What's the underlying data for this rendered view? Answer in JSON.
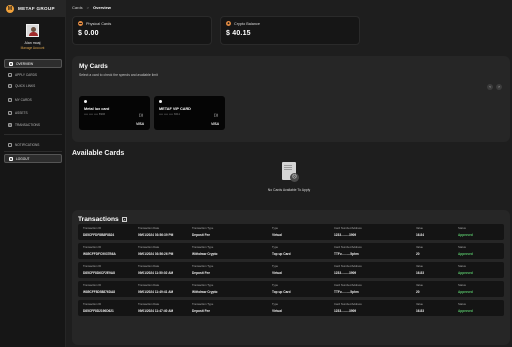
{
  "app": {
    "logo_text": "METAF GROUP"
  },
  "profile": {
    "name": "Alan moaj",
    "link": "Manage Account"
  },
  "nav": {
    "items": [
      {
        "label": "OVERVIEW",
        "icon": "O"
      },
      {
        "label": "APPLY CARDS",
        "icon": "+"
      },
      {
        "label": "QUICK LINKS",
        "icon": "≡"
      },
      {
        "label": "MY CARDS",
        "icon": "▭"
      },
      {
        "label": "ASSETS",
        "icon": "◇"
      },
      {
        "label": "TRANSACTIONS",
        "icon": "⇄"
      }
    ],
    "notifications": {
      "label": "NOTIFICATIONS",
      "icon": "!"
    },
    "logout": {
      "label": "LOGOUT",
      "icon": "⏻"
    }
  },
  "breadcrumb": {
    "root": "Cards",
    "separator": ">",
    "current": "Overview"
  },
  "stats": [
    {
      "label": "Physical Cards",
      "value": "$ 0.00",
      "icon": "credit-card-icon"
    },
    {
      "label": "Crypto Balance",
      "value": "$ 40.15",
      "icon": "crypto-icon"
    }
  ],
  "my_cards": {
    "title": "My Cards",
    "subtitle": "Select a card to check the spends and available limit",
    "cards": [
      {
        "name": "Metal lux card",
        "number": "•••• •••• •••• 8906",
        "brand": "VISA"
      },
      {
        "name": "METAF VIP CARD",
        "number": "•••• •••• •••• 3011",
        "brand": "VISA"
      }
    ],
    "prev": "‹",
    "next": "›"
  },
  "available_cards": {
    "title": "Available Cards",
    "empty_text": "No Cards Available To Apply"
  },
  "transactions": {
    "title": "Transactions",
    "headers": {
      "id": "Transaction ID",
      "date": "Transaction Date",
      "type": "Transaction Type",
      "kind": "Type",
      "card": "Card Number/Address",
      "value": "Value",
      "status": "Status"
    },
    "rows": [
      {
        "id": "D85CFFDF8B8F8824",
        "date": "09/01/2024 03:56:39 PM",
        "type": "Deposit Fee",
        "kind": "Virtual",
        "card": "1233.........3909",
        "value": "16.84",
        "status": "Approved"
      },
      {
        "id": "W85CFFDFC9037B6A",
        "date": "09/01/2024 03:56:26 PM",
        "type": "Withdraw Crypto",
        "kind": "Top up Card",
        "card": "TTFv..........5phm",
        "value": "20",
        "status": "Approved"
      },
      {
        "id": "D85CFF8D6CF2E9A8",
        "date": "09/01/2024 11:50:02 AM",
        "type": "Deposit Fee",
        "kind": "Virtual",
        "card": "1233.........3909",
        "value": "16.83",
        "status": "Approved"
      },
      {
        "id": "W85CFF8D58876DA8",
        "date": "09/01/2024 11:49:41 AM",
        "type": "Withdraw Crypto",
        "kind": "Top up Card",
        "card": "TTFv..........5phm",
        "value": "20",
        "status": "Approved"
      },
      {
        "id": "D85CFF8D2196D621",
        "date": "09/01/2024 11:47:40 AM",
        "type": "Deposit Fee",
        "kind": "Virtual",
        "card": "1233.........3909",
        "value": "16.83",
        "status": "Approved"
      }
    ]
  },
  "colors": {
    "accent": "#f2a23a",
    "approved": "#59c46a",
    "panel": "#262626",
    "background": "#1e1e1e"
  }
}
